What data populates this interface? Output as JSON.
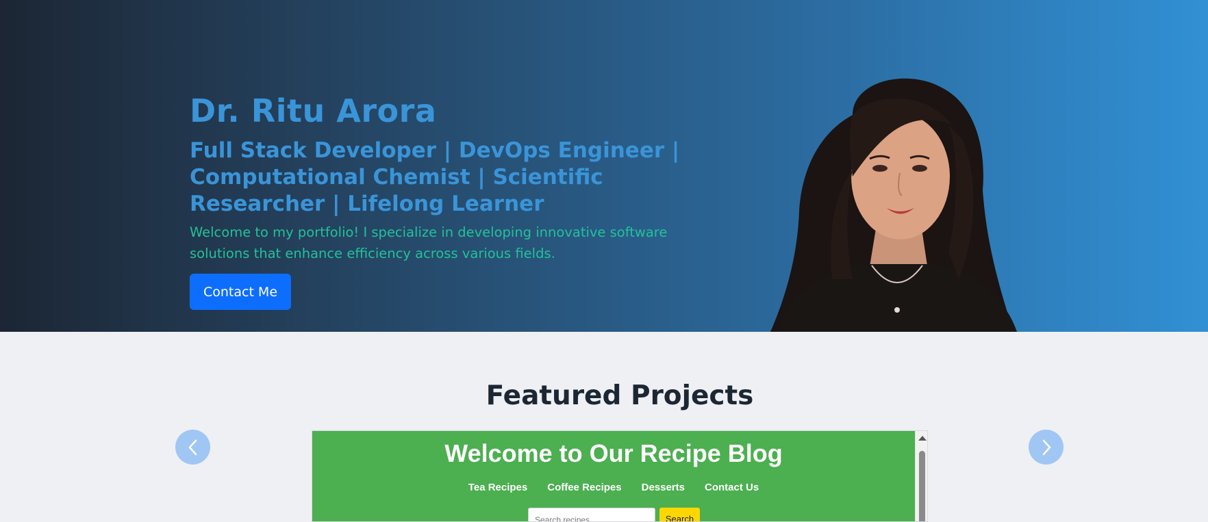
{
  "hero": {
    "name": "Dr. Ritu Arora",
    "roles": "Full Stack Developer | DevOps Engineer | Computational Chemist | Scientific Researcher | Lifelong Learner",
    "intro": "Welcome to my portfolio! I specialize in developing innovative software solutions that enhance efficiency across various fields.",
    "contact_button": "Contact Me"
  },
  "featured": {
    "title": "Featured Projects",
    "prev_icon": "chevron-left-icon",
    "next_icon": "chevron-right-icon",
    "project": {
      "title": "Welcome to Our Recipe Blog",
      "nav": [
        "Tea Recipes",
        "Coffee Recipes",
        "Desserts",
        "Contact Us"
      ],
      "search_placeholder": "Search recipes...",
      "search_button": "Search"
    }
  },
  "colors": {
    "accent_blue": "#3a94d8",
    "intro_green": "#22c29a",
    "button_blue": "#0d6efd",
    "recipe_green": "#4caf50",
    "search_yellow": "#ffd700"
  }
}
